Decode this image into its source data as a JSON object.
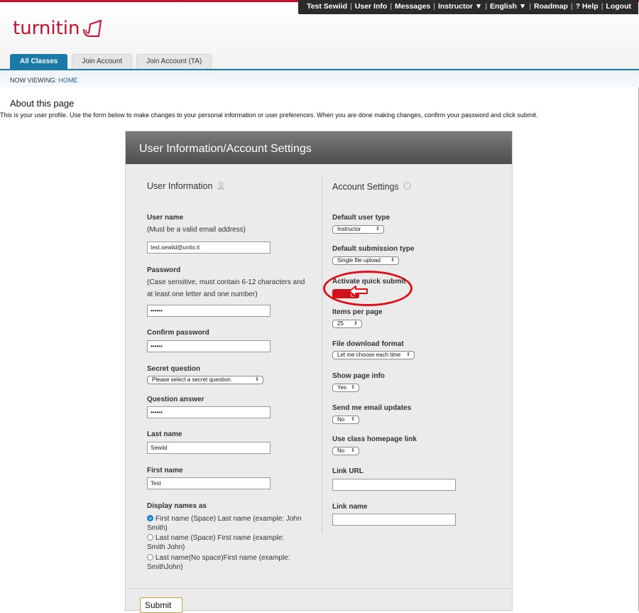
{
  "topnav": {
    "items": [
      "Test Sewiid",
      "User Info",
      "Messages",
      "Instructor ▼",
      "English ▼",
      "Roadmap",
      "? Help",
      "Logout"
    ]
  },
  "logo": {
    "text": "turnitin"
  },
  "tabs": [
    {
      "label": "All Classes",
      "active": true
    },
    {
      "label": "Join Account",
      "active": false
    },
    {
      "label": "Join Account (TA)",
      "active": false
    }
  ],
  "now_viewing": {
    "prefix": "NOW VIEWING: ",
    "location": "HOME"
  },
  "about": {
    "title": "About this page",
    "text": "This is your user profile. Use the form below to make changes to your personal information or user preferences. When you are done making changes, confirm your password and click submit."
  },
  "panel": {
    "title": "User Information/Account Settings",
    "user_info": {
      "title": "User Information",
      "username_label": "User name",
      "username_hint": "(Must be a valid email address)",
      "username_value": "test.sewiid@unito.it",
      "password_label": "Password",
      "password_hint": "(Case sensitive, must contain 6-12 characters and at least one letter and one number)",
      "password_value": "••••••",
      "confirm_label": "Confirm password",
      "confirm_value": "••••••",
      "secret_q_label": "Secret question",
      "secret_q_value": "Please select a secret question.",
      "answer_label": "Question answer",
      "answer_value": "••••••",
      "lastname_label": "Last name",
      "lastname_value": "Sewiid",
      "firstname_label": "First name",
      "firstname_value": "Test",
      "display_label": "Display names as",
      "display_options": [
        {
          "label": "First name (Space) Last name (example: John Smith)",
          "selected": true
        },
        {
          "label": "Last name (Space) First name (example: Smith John)",
          "selected": false
        },
        {
          "label": "Last name(No space)First name (example: SmithJohn)",
          "selected": false
        }
      ]
    },
    "account": {
      "title": "Account Settings",
      "user_type_label": "Default user type",
      "user_type_value": "Instructor",
      "submission_label": "Default submission type",
      "submission_value": "Single file upload",
      "quick_submit_label": "Activate quick submit",
      "items_label": "Items per page",
      "items_value": "25",
      "download_label": "File download format",
      "download_value": "Let me choose each time",
      "pageinfo_label": "Show page info",
      "pageinfo_value": "Yes",
      "email_label": "Send me email updates",
      "email_value": "No",
      "classlink_label": "Use class homepage link",
      "classlink_value": "No",
      "linkurl_label": "Link URL",
      "linkname_label": "Link name"
    },
    "submit_label": "Submit"
  },
  "colors": {
    "brand_red": "#c8102e",
    "tab_blue": "#1b7ba8",
    "annotation_red": "#e0101b"
  }
}
